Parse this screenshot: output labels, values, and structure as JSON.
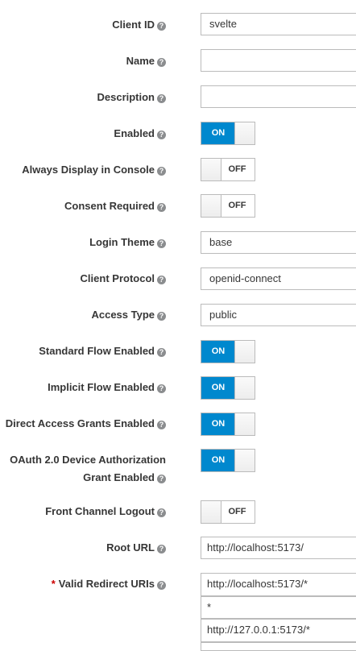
{
  "fields": {
    "client_id": {
      "label": "Client ID",
      "value": "svelte"
    },
    "name": {
      "label": "Name",
      "value": ""
    },
    "description": {
      "label": "Description",
      "value": ""
    },
    "enabled": {
      "label": "Enabled",
      "state": "ON"
    },
    "always_display": {
      "label": "Always Display in Console",
      "state": "OFF"
    },
    "consent_required": {
      "label": "Consent Required",
      "state": "OFF"
    },
    "login_theme": {
      "label": "Login Theme",
      "value": "base"
    },
    "client_protocol": {
      "label": "Client Protocol",
      "value": "openid-connect"
    },
    "access_type": {
      "label": "Access Type",
      "value": "public"
    },
    "standard_flow": {
      "label": "Standard Flow Enabled",
      "state": "ON"
    },
    "implicit_flow": {
      "label": "Implicit Flow Enabled",
      "state": "ON"
    },
    "direct_access": {
      "label": "Direct Access Grants Enabled",
      "state": "ON"
    },
    "device_auth": {
      "label_line1": "OAuth 2.0 Device Authorization",
      "label_line2": "Grant Enabled",
      "state": "ON"
    },
    "front_channel_logout": {
      "label": "Front Channel Logout",
      "state": "OFF"
    },
    "root_url": {
      "label": "Root URL",
      "value": "http://localhost:5173/"
    },
    "valid_redirect_uris": {
      "required_marker": "*",
      "label": "Valid Redirect URIs",
      "values": [
        "http://localhost:5173/*",
        "*",
        "http://127.0.0.1:5173/*",
        ""
      ]
    }
  },
  "icons": {
    "help": "question-circle-icon"
  },
  "colors": {
    "toggle_on": "#0088ce",
    "required": "#cc0000"
  }
}
